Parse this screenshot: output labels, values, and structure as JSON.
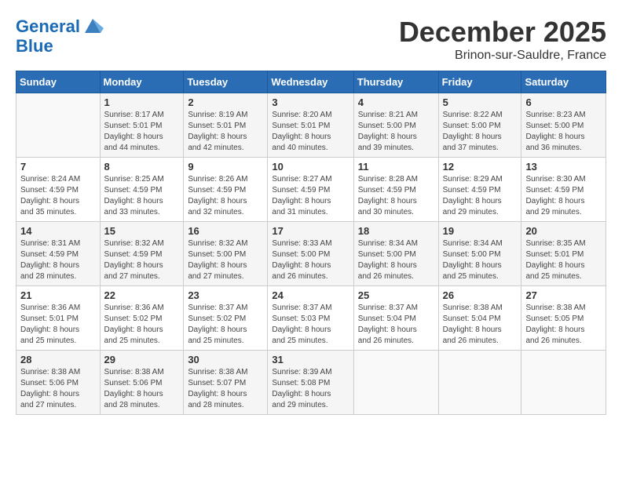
{
  "header": {
    "logo_line1": "General",
    "logo_line2": "Blue",
    "month": "December 2025",
    "location": "Brinon-sur-Sauldre, France"
  },
  "weekdays": [
    "Sunday",
    "Monday",
    "Tuesday",
    "Wednesday",
    "Thursday",
    "Friday",
    "Saturday"
  ],
  "weeks": [
    [
      {
        "day": "",
        "info": ""
      },
      {
        "day": "1",
        "info": "Sunrise: 8:17 AM\nSunset: 5:01 PM\nDaylight: 8 hours\nand 44 minutes."
      },
      {
        "day": "2",
        "info": "Sunrise: 8:19 AM\nSunset: 5:01 PM\nDaylight: 8 hours\nand 42 minutes."
      },
      {
        "day": "3",
        "info": "Sunrise: 8:20 AM\nSunset: 5:01 PM\nDaylight: 8 hours\nand 40 minutes."
      },
      {
        "day": "4",
        "info": "Sunrise: 8:21 AM\nSunset: 5:00 PM\nDaylight: 8 hours\nand 39 minutes."
      },
      {
        "day": "5",
        "info": "Sunrise: 8:22 AM\nSunset: 5:00 PM\nDaylight: 8 hours\nand 37 minutes."
      },
      {
        "day": "6",
        "info": "Sunrise: 8:23 AM\nSunset: 5:00 PM\nDaylight: 8 hours\nand 36 minutes."
      }
    ],
    [
      {
        "day": "7",
        "info": "Sunrise: 8:24 AM\nSunset: 4:59 PM\nDaylight: 8 hours\nand 35 minutes."
      },
      {
        "day": "8",
        "info": "Sunrise: 8:25 AM\nSunset: 4:59 PM\nDaylight: 8 hours\nand 33 minutes."
      },
      {
        "day": "9",
        "info": "Sunrise: 8:26 AM\nSunset: 4:59 PM\nDaylight: 8 hours\nand 32 minutes."
      },
      {
        "day": "10",
        "info": "Sunrise: 8:27 AM\nSunset: 4:59 PM\nDaylight: 8 hours\nand 31 minutes."
      },
      {
        "day": "11",
        "info": "Sunrise: 8:28 AM\nSunset: 4:59 PM\nDaylight: 8 hours\nand 30 minutes."
      },
      {
        "day": "12",
        "info": "Sunrise: 8:29 AM\nSunset: 4:59 PM\nDaylight: 8 hours\nand 29 minutes."
      },
      {
        "day": "13",
        "info": "Sunrise: 8:30 AM\nSunset: 4:59 PM\nDaylight: 8 hours\nand 29 minutes."
      }
    ],
    [
      {
        "day": "14",
        "info": "Sunrise: 8:31 AM\nSunset: 4:59 PM\nDaylight: 8 hours\nand 28 minutes."
      },
      {
        "day": "15",
        "info": "Sunrise: 8:32 AM\nSunset: 4:59 PM\nDaylight: 8 hours\nand 27 minutes."
      },
      {
        "day": "16",
        "info": "Sunrise: 8:32 AM\nSunset: 5:00 PM\nDaylight: 8 hours\nand 27 minutes."
      },
      {
        "day": "17",
        "info": "Sunrise: 8:33 AM\nSunset: 5:00 PM\nDaylight: 8 hours\nand 26 minutes."
      },
      {
        "day": "18",
        "info": "Sunrise: 8:34 AM\nSunset: 5:00 PM\nDaylight: 8 hours\nand 26 minutes."
      },
      {
        "day": "19",
        "info": "Sunrise: 8:34 AM\nSunset: 5:00 PM\nDaylight: 8 hours\nand 25 minutes."
      },
      {
        "day": "20",
        "info": "Sunrise: 8:35 AM\nSunset: 5:01 PM\nDaylight: 8 hours\nand 25 minutes."
      }
    ],
    [
      {
        "day": "21",
        "info": "Sunrise: 8:36 AM\nSunset: 5:01 PM\nDaylight: 8 hours\nand 25 minutes."
      },
      {
        "day": "22",
        "info": "Sunrise: 8:36 AM\nSunset: 5:02 PM\nDaylight: 8 hours\nand 25 minutes."
      },
      {
        "day": "23",
        "info": "Sunrise: 8:37 AM\nSunset: 5:02 PM\nDaylight: 8 hours\nand 25 minutes."
      },
      {
        "day": "24",
        "info": "Sunrise: 8:37 AM\nSunset: 5:03 PM\nDaylight: 8 hours\nand 25 minutes."
      },
      {
        "day": "25",
        "info": "Sunrise: 8:37 AM\nSunset: 5:04 PM\nDaylight: 8 hours\nand 26 minutes."
      },
      {
        "day": "26",
        "info": "Sunrise: 8:38 AM\nSunset: 5:04 PM\nDaylight: 8 hours\nand 26 minutes."
      },
      {
        "day": "27",
        "info": "Sunrise: 8:38 AM\nSunset: 5:05 PM\nDaylight: 8 hours\nand 26 minutes."
      }
    ],
    [
      {
        "day": "28",
        "info": "Sunrise: 8:38 AM\nSunset: 5:06 PM\nDaylight: 8 hours\nand 27 minutes."
      },
      {
        "day": "29",
        "info": "Sunrise: 8:38 AM\nSunset: 5:06 PM\nDaylight: 8 hours\nand 28 minutes."
      },
      {
        "day": "30",
        "info": "Sunrise: 8:38 AM\nSunset: 5:07 PM\nDaylight: 8 hours\nand 28 minutes."
      },
      {
        "day": "31",
        "info": "Sunrise: 8:39 AM\nSunset: 5:08 PM\nDaylight: 8 hours\nand 29 minutes."
      },
      {
        "day": "",
        "info": ""
      },
      {
        "day": "",
        "info": ""
      },
      {
        "day": "",
        "info": ""
      }
    ]
  ]
}
